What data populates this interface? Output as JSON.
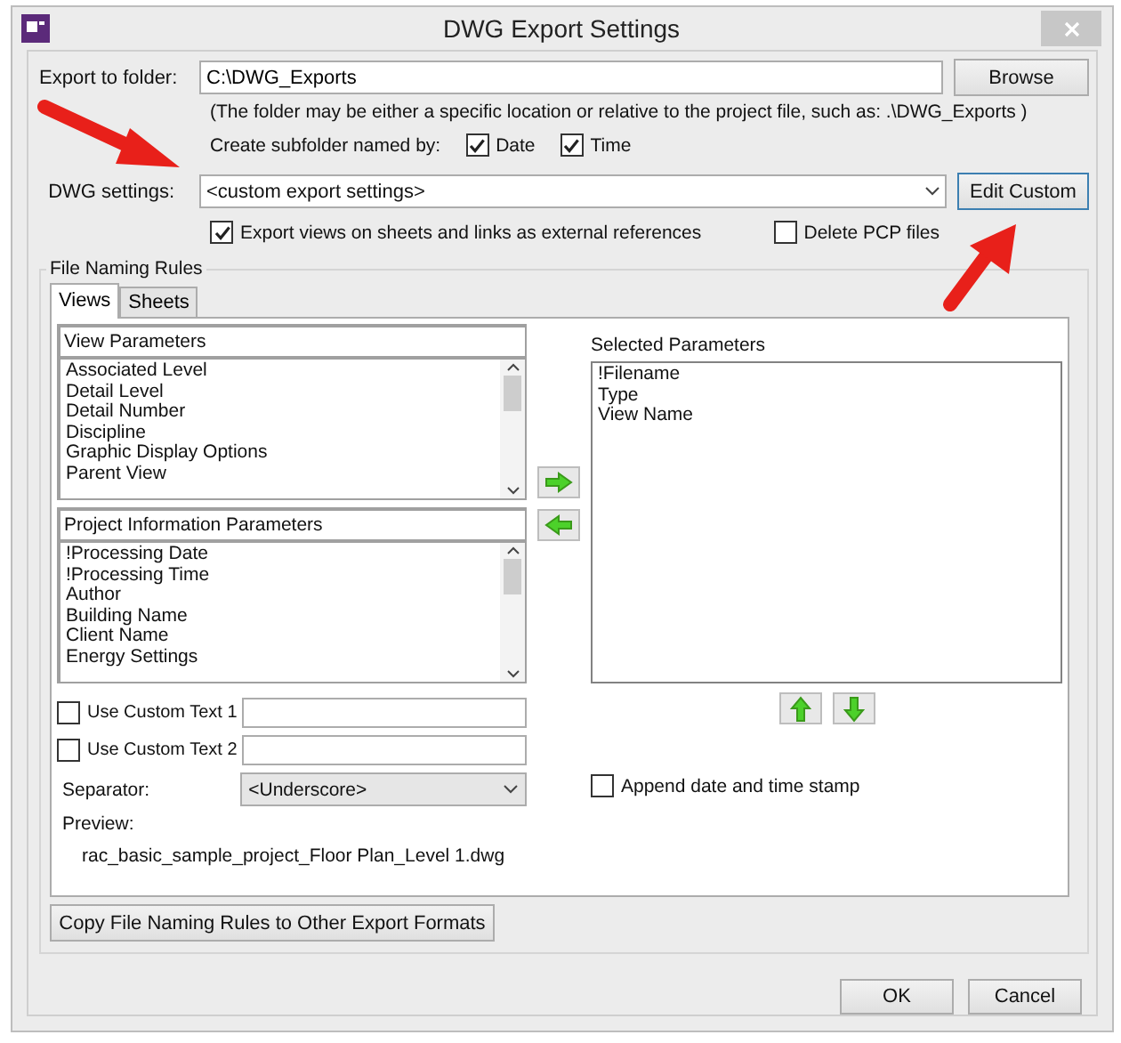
{
  "window": {
    "title": "DWG Export Settings"
  },
  "export_folder": {
    "label": "Export to folder:",
    "value": "C:\\DWG_Exports",
    "browse_button": "Browse",
    "hint": "(The folder may be either a specific location or relative to the project file, such as:  .\\DWG_Exports )"
  },
  "subfolder": {
    "label": "Create subfolder named by:",
    "options": [
      {
        "label": "Date",
        "checked": true
      },
      {
        "label": "Time",
        "checked": true
      }
    ]
  },
  "dwg_settings": {
    "label": "DWG settings:",
    "value": "<custom export settings>",
    "edit_button": "Edit Custom"
  },
  "options": [
    {
      "label": "Export views on sheets and links as external references",
      "checked": true
    },
    {
      "label": "Delete PCP files",
      "checked": false
    }
  ],
  "file_naming_rules": {
    "title": "File Naming Rules",
    "tabs": [
      {
        "label": "Views",
        "selected": true
      },
      {
        "label": "Sheets",
        "selected": false
      }
    ],
    "view_parameters": {
      "title": "View Parameters",
      "items": [
        "Associated Level",
        "Detail Level",
        "Detail Number",
        "Discipline",
        "Graphic Display Options",
        "Parent View"
      ]
    },
    "project_parameters": {
      "title": "Project Information Parameters",
      "items": [
        "!Processing Date",
        "!Processing Time",
        "Author",
        "Building Name",
        "Client Name",
        "Energy Settings"
      ]
    },
    "selected_parameters": {
      "title": "Selected Parameters",
      "items": [
        "!Filename",
        "Type",
        "View Name"
      ]
    },
    "custom_texts": [
      {
        "label": "Use Custom Text 1",
        "checked": false
      },
      {
        "label": "Use Custom Text 2",
        "checked": false
      }
    ],
    "separator": {
      "label": "Separator:",
      "value": "<Underscore>"
    },
    "append_timestamp": {
      "label": "Append date and time stamp",
      "checked": false
    },
    "preview": {
      "label": "Preview:",
      "value": "rac_basic_sample_project_Floor Plan_Level 1.dwg"
    }
  },
  "copy_button": "Copy File Naming Rules to Other Export Formats",
  "buttons": [
    "OK",
    "Cancel"
  ]
}
